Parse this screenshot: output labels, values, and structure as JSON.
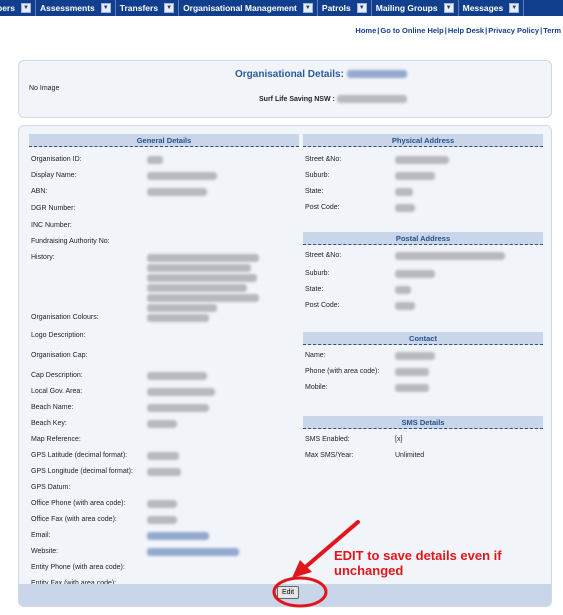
{
  "nav": {
    "items": [
      {
        "label": "bers"
      },
      {
        "label": "Assessments"
      },
      {
        "label": "Transfers"
      },
      {
        "label": "Organisational Management"
      },
      {
        "label": "Patrols"
      },
      {
        "label": "Mailing Groups"
      },
      {
        "label": "Messages"
      }
    ]
  },
  "links": {
    "home": "Home",
    "help": "Go to Online Help",
    "desk": "Help Desk",
    "privacy": "Privacy Policy",
    "terms": "Term"
  },
  "header": {
    "no_image": "No Image",
    "title": "Organisational Details:",
    "subtitle": "Surf Life Saving NSW :"
  },
  "general": {
    "title": "General Details",
    "rows": [
      {
        "label": "Organisation ID:"
      },
      {
        "label": "Display Name:"
      },
      {
        "label": "ABN:"
      },
      {
        "label": "DGR Number:"
      },
      {
        "label": "INC Number:"
      },
      {
        "label": "Fundraising Authority No:"
      },
      {
        "label": "History:"
      },
      {
        "label": "Organisation Colours:"
      },
      {
        "label": "Logo Description:"
      },
      {
        "label": "Organisation Cap:"
      },
      {
        "label": "Cap Description:"
      },
      {
        "label": "Local Gov. Area:"
      },
      {
        "label": "Beach Name:"
      },
      {
        "label": "Beach Key:"
      },
      {
        "label": "Map Reference:"
      },
      {
        "label": "GPS Latitude (decimal format):"
      },
      {
        "label": "GPS Longitude (decimal format):"
      },
      {
        "label": "GPS Datum:"
      },
      {
        "label": "Office Phone (with area code):"
      },
      {
        "label": "Office Fax (with area code):"
      },
      {
        "label": "Email:"
      },
      {
        "label": "Website:"
      },
      {
        "label": "Entity Phone (with area code):"
      },
      {
        "label": "Entity Fax (with area code):"
      }
    ]
  },
  "physical": {
    "title": "Physical Address",
    "rows": [
      {
        "label": "Street &No:"
      },
      {
        "label": "Suburb:"
      },
      {
        "label": "State:"
      },
      {
        "label": "Post Code:"
      }
    ]
  },
  "postal": {
    "title": "Postal Address",
    "rows": [
      {
        "label": "Street &No:"
      },
      {
        "label": "Suburb:"
      },
      {
        "label": "State:"
      },
      {
        "label": "Post Code:"
      }
    ]
  },
  "contact": {
    "title": "Contact",
    "rows": [
      {
        "label": "Name:"
      },
      {
        "label": "Phone (with area code):"
      },
      {
        "label": "Mobile:"
      }
    ]
  },
  "sms": {
    "title": "SMS Details",
    "rows": [
      {
        "label": "SMS Enabled:",
        "value": "[x]"
      },
      {
        "label": "Max SMS/Year:",
        "value": "Unlimited"
      }
    ]
  },
  "edit_label": "Edit",
  "annotation": "EDIT to save details even if unchanged",
  "colors": {
    "nav_bg": "#123f8d",
    "section_head": "#c9d5e8",
    "annotation": "#e1161b"
  }
}
